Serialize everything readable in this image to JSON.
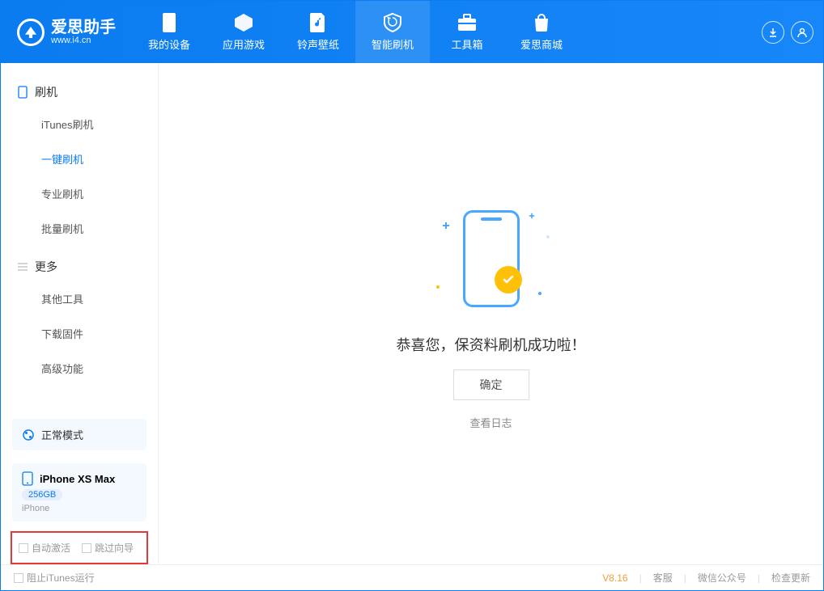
{
  "brand": {
    "name": "爱思助手",
    "url": "www.i4.cn"
  },
  "tabs": {
    "t0": "我的设备",
    "t1": "应用游戏",
    "t2": "铃声壁纸",
    "t3": "智能刷机",
    "t4": "工具箱",
    "t5": "爱思商城"
  },
  "sidebar": {
    "flash_header": "刷机",
    "items": {
      "itunes": "iTunes刷机",
      "onekey": "一键刷机",
      "pro": "专业刷机",
      "batch": "批量刷机"
    },
    "more_header": "更多",
    "more": {
      "other": "其他工具",
      "firmware": "下载固件",
      "advanced": "高级功能"
    },
    "mode": "正常模式",
    "device_name": "iPhone XS Max",
    "capacity": "256GB",
    "device_type": "iPhone",
    "chk_auto_activate": "自动激活",
    "chk_skip_guide": "跳过向导"
  },
  "main": {
    "success": "恭喜您，保资料刷机成功啦！",
    "ok": "确定",
    "view_log": "查看日志"
  },
  "footer": {
    "block_itunes": "阻止iTunes运行",
    "version": "V8.16",
    "support": "客服",
    "wechat": "微信公众号",
    "update": "检查更新"
  }
}
